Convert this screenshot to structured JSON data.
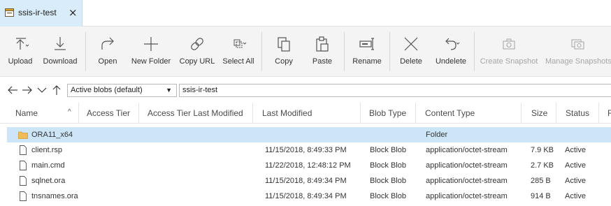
{
  "tab": {
    "title": "ssis-ir-test",
    "close": "×"
  },
  "toolbar": {
    "upload": "Upload",
    "download": "Download",
    "open": "Open",
    "new_folder": "New Folder",
    "copy_url": "Copy URL",
    "select_all": "Select All",
    "copy": "Copy",
    "paste": "Paste",
    "rename": "Rename",
    "delete": "Delete",
    "undelete": "Undelete",
    "create_snapshot": "Create Snapshot",
    "manage_snapshots": "Manage Snapshots"
  },
  "nav": {
    "blob_filter": "Active blobs (default)",
    "path": "ssis-ir-test"
  },
  "columns": [
    "Name",
    "Access Tier",
    "Access Tier Last Modified",
    "Last Modified",
    "Blob Type",
    "Content Type",
    "Size",
    "Status",
    "R"
  ],
  "rows": [
    {
      "name": "ORA11_x64",
      "last_modified": "",
      "blob_type": "",
      "content_type": "Folder",
      "size": "",
      "status": ""
    },
    {
      "name": "client.rsp",
      "last_modified": "11/15/2018, 8:49:33 PM",
      "blob_type": "Block Blob",
      "content_type": "application/octet-stream",
      "size": "7.9 KB",
      "status": "Active"
    },
    {
      "name": "main.cmd",
      "last_modified": "11/22/2018, 12:48:12 PM",
      "blob_type": "Block Blob",
      "content_type": "application/octet-stream",
      "size": "2.7 KB",
      "status": "Active"
    },
    {
      "name": "sqlnet.ora",
      "last_modified": "11/15/2018, 8:49:34 PM",
      "blob_type": "Block Blob",
      "content_type": "application/octet-stream",
      "size": "285 B",
      "status": "Active"
    },
    {
      "name": "tnsnames.ora",
      "last_modified": "11/15/2018, 8:49:34 PM",
      "blob_type": "Block Blob",
      "content_type": "application/octet-stream",
      "size": "914 B",
      "status": "Active"
    }
  ],
  "colors": {
    "selected_row": "#cde6f7",
    "tab_bg": "#d9ecf9",
    "folder": "#f0b95a"
  }
}
